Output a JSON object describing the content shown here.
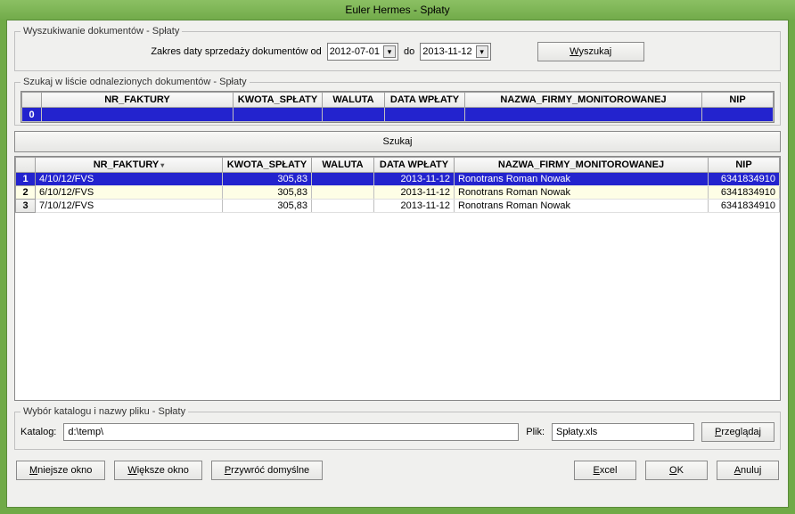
{
  "title": "Euler Hermes - Spłaty",
  "search_box": {
    "legend": "Wyszukiwanie dokumentów - Spłaty",
    "range_label": "Zakres daty sprzedaży dokumentów od",
    "date_from": "2012-07-01",
    "range_to_label": "do",
    "date_to": "2013-11-12",
    "search_btn": "Wyszukaj"
  },
  "found_box": {
    "legend": "Szukaj w liście odnalezionych dokumentów - Spłaty",
    "columns": [
      "NR_FAKTURY",
      "KWOTA_SPŁATY",
      "WALUTA",
      "DATA WPŁATY",
      "NAZWA_FIRMY_MONITOROWANEJ",
      "NIP"
    ],
    "row_label": "0",
    "szukaj_btn": "Szukaj"
  },
  "results": {
    "columns": [
      "NR_FAKTURY",
      "KWOTA_SPŁATY",
      "WALUTA",
      "DATA WPŁATY",
      "NAZWA_FIRMY_MONITOROWANEJ",
      "NIP"
    ],
    "rows": [
      {
        "n": "1",
        "nr": "4/10/12/FVS",
        "kwota": "305,83",
        "waluta": "",
        "data": "2013-11-12",
        "firma": "Ronotrans Roman Nowak",
        "nip": "6341834910",
        "selected": true
      },
      {
        "n": "2",
        "nr": "6/10/12/FVS",
        "kwota": "305,83",
        "waluta": "",
        "data": "2013-11-12",
        "firma": "Ronotrans Roman Nowak",
        "nip": "6341834910",
        "alt": true
      },
      {
        "n": "3",
        "nr": "7/10/12/FVS",
        "kwota": "305,83",
        "waluta": "",
        "data": "2013-11-12",
        "firma": "Ronotrans Roman Nowak",
        "nip": "6341834910"
      }
    ]
  },
  "file_box": {
    "legend": "Wybór katalogu i nazwy pliku - Spłaty",
    "katalog_label": "Katalog:",
    "katalog_value": "d:\\temp\\",
    "plik_label": "Plik:",
    "plik_value": "Spłaty.xls",
    "browse_btn": "Przeglądaj"
  },
  "buttons": {
    "smaller": "Mniejsze okno",
    "bigger": "Większe okno",
    "restore": "Przywróć domyślne",
    "excel": "Excel",
    "ok": "OK",
    "cancel": "Anuluj"
  }
}
